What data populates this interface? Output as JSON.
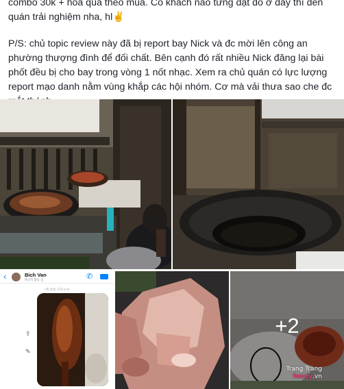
{
  "post": {
    "line1": "combo 30k + hoa quả theo mùa. Có khách nào từng đặt đồ ở đây thì đến quán trải nghiệm nha, hl",
    "line1_emoji": "✌",
    "line2": "P/S: chủ topic review này đã bị report bay Nick và đc mời lên công an phường thượng đình để đối chất. Bên cạnh đó rất nhiều Nick đăng lại bài phốt đều bị cho bay trong vòng 1 nốt nhạc. Xem ra chủ quán có lực lượng report mạo danh nằm vùng khắp các hội nhóm. Cơ mà vải thưa sao che đc mắt thánh."
  },
  "chat": {
    "back_icon": "‹",
    "name": "Bich Van",
    "subtitle": "메신저 활동 중",
    "phone_icon": "✆",
    "time": "1월 28일 오후 6:03",
    "share_icon": "⇪",
    "edit_icon": "✎"
  },
  "more_photos": {
    "count_label": "+2",
    "watermark_line1": "Trang Trang",
    "watermark_brand": "foody",
    "watermark_suffix": ".vn"
  }
}
